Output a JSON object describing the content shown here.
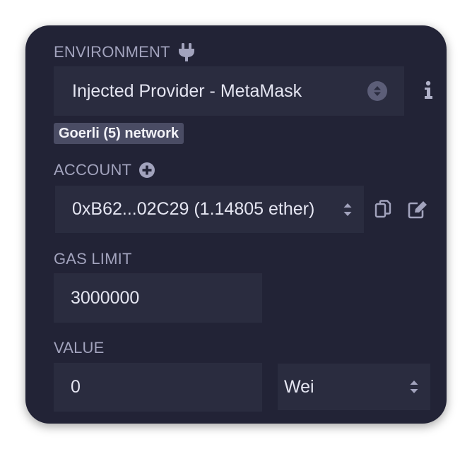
{
  "environment": {
    "label": "ENVIRONMENT",
    "plug_icon": "plug-icon",
    "selected": "Injected Provider - MetaMask",
    "info_icon": "info-icon",
    "network_badge": "Goerli (5) network"
  },
  "account": {
    "label": "ACCOUNT",
    "add_icon": "plus-circle-icon",
    "selected": "0xB62...02C29 (1.14805 ether)",
    "copy_icon": "copy-icon",
    "edit_icon": "edit-icon"
  },
  "gas_limit": {
    "label": "GAS LIMIT",
    "value": "3000000"
  },
  "value": {
    "label": "VALUE",
    "amount": "0",
    "unit": "Wei"
  },
  "colors": {
    "panel_bg": "#222336",
    "field_bg": "#2a2c3f",
    "label_text": "#a2a3bd",
    "value_text": "#e4e5f1",
    "badge_bg": "#4a4c64"
  }
}
